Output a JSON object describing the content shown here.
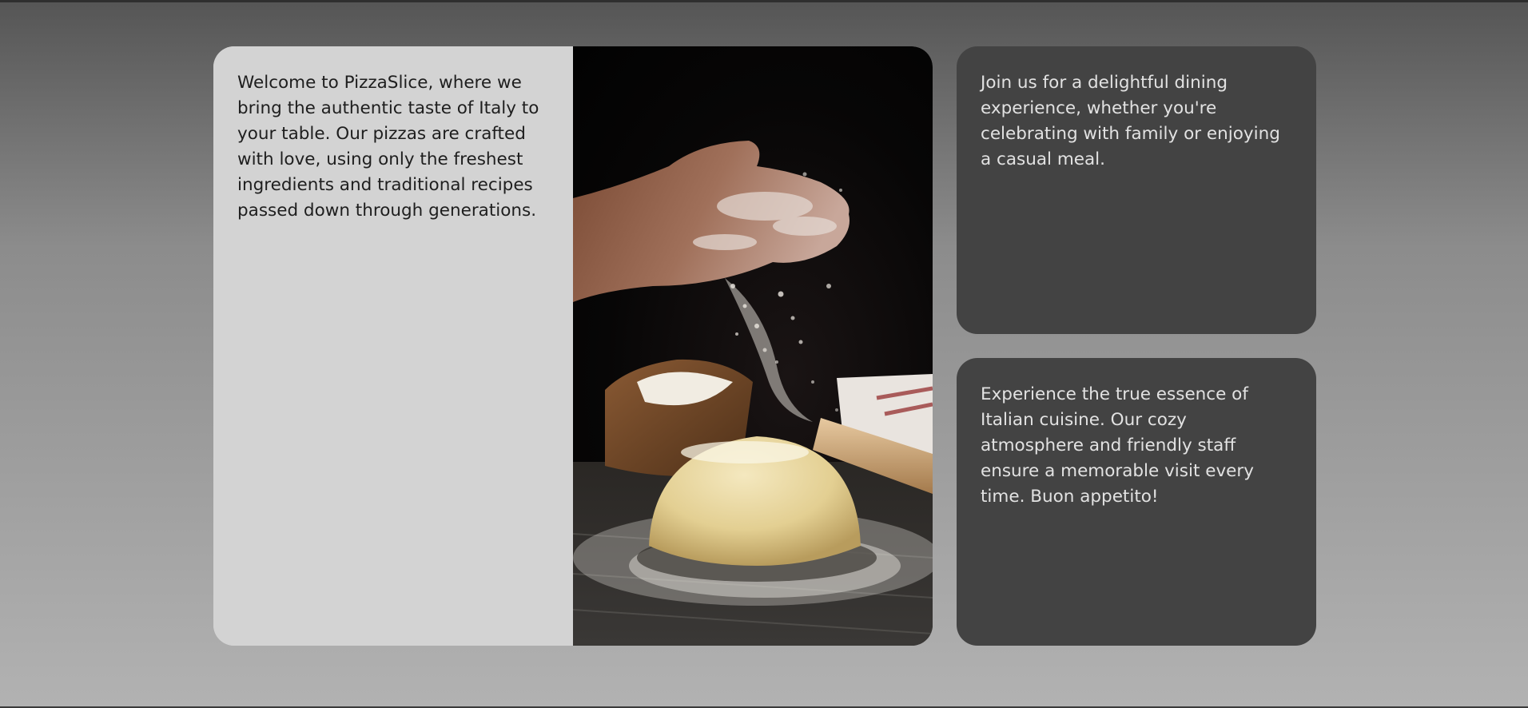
{
  "cards": {
    "welcome": "Welcome to PizzaSlice, where we bring the authentic taste of Italy to your table. Our pizzas are crafted with love, using only the freshest ingredients and traditional recipes passed down through generations.",
    "join": "Join us for a delightful dining experience, whether you're celebrating with family or enjoying a casual meal.",
    "experience": "Experience the true essence of Italian cuisine. Our cozy atmosphere and friendly staff ensure a memorable visit every time. Buon appetito!"
  },
  "colors": {
    "light_card": "#d3d3d3",
    "dark_card": "#434343",
    "dark_text": "#1e1e1e",
    "light_text": "#e2e2e2"
  },
  "image": {
    "subject": "flour-hands-dough-photo"
  }
}
